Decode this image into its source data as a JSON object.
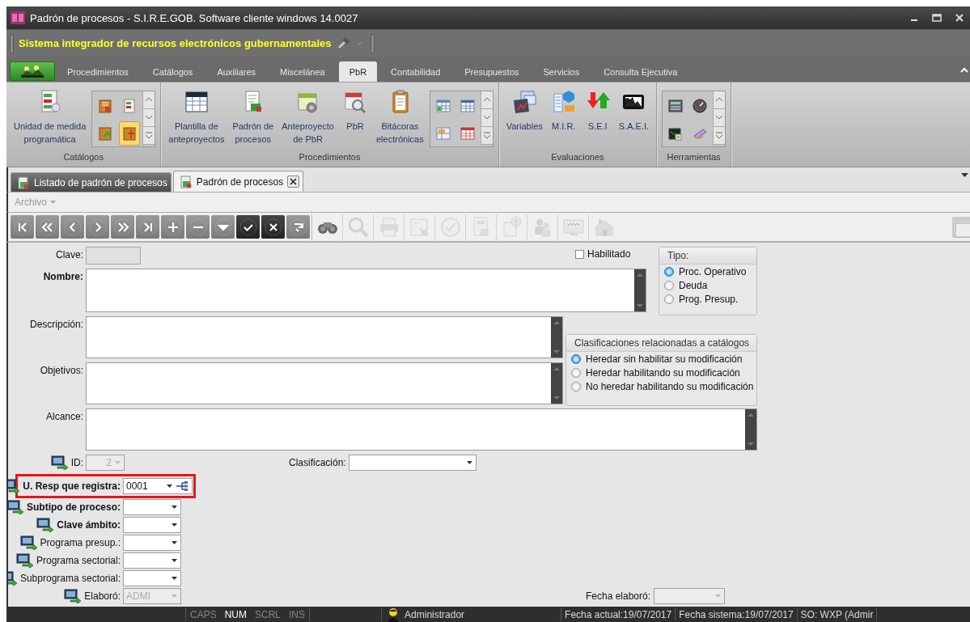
{
  "window": {
    "title": "Padrón de procesos - S.I.R.E.GOB. Software cliente windows 14.0027"
  },
  "header": {
    "system_name": "Sistema integrador de recursos electrónicos gubernamentales"
  },
  "ribbon_tabs": [
    {
      "label": "Procedimientos",
      "selected": false
    },
    {
      "label": "Catálogos",
      "selected": false
    },
    {
      "label": "Auxiliares",
      "selected": false
    },
    {
      "label": "Miscelánea",
      "selected": false
    },
    {
      "label": "PbR",
      "selected": true
    },
    {
      "label": "Contabilidad",
      "selected": false
    },
    {
      "label": "Presupuestos",
      "selected": false
    },
    {
      "label": "Servicios",
      "selected": false
    },
    {
      "label": "Consulta Ejecutiva",
      "selected": false
    }
  ],
  "ribbon_groups": [
    {
      "label": "Catálogos",
      "items": [
        {
          "kind": "large",
          "label": "Unidad de medida\nprogramática"
        },
        {
          "kind": "gallery",
          "cells": [
            {
              "selected": false
            },
            {
              "selected": false
            },
            {
              "selected": false
            },
            {
              "selected": true
            }
          ]
        }
      ]
    },
    {
      "label": "Procedimientos",
      "items": [
        {
          "kind": "large",
          "label": "Plantilla de\nanteproyectos"
        },
        {
          "kind": "large",
          "label": "Padrón de\nprocesos"
        },
        {
          "kind": "large",
          "label": "Anteproyecto\nde PbR"
        },
        {
          "kind": "large",
          "label": "PbR"
        },
        {
          "kind": "large",
          "label": "Bitácoras\nelectrónicas"
        },
        {
          "kind": "gallery",
          "cells": [
            {
              "selected": false
            },
            {
              "selected": false
            },
            {
              "selected": false
            },
            {
              "selected": false
            }
          ]
        }
      ]
    },
    {
      "label": "Evaluaciones",
      "items": [
        {
          "kind": "large",
          "label": "Variables"
        },
        {
          "kind": "large",
          "label": "M.I.R."
        },
        {
          "kind": "large",
          "label": "S.E.I"
        },
        {
          "kind": "large",
          "label": "S.A.E.I."
        }
      ]
    },
    {
      "label": "Herramientas",
      "items": [
        {
          "kind": "gallery",
          "cells": [
            {
              "selected": false
            },
            {
              "selected": false
            },
            {
              "selected": false
            },
            {
              "selected": false
            }
          ]
        }
      ]
    }
  ],
  "document_tabs": [
    {
      "label": "Listado de padrón de procesos",
      "selected": false,
      "closable": false
    },
    {
      "label": "Padrón de procesos",
      "selected": true,
      "closable": true
    }
  ],
  "menu": [
    {
      "label": "Archivo",
      "disabled": true
    }
  ],
  "toolbar": [
    {
      "kind": "first",
      "disabled": true
    },
    {
      "kind": "prev-page",
      "disabled": true
    },
    {
      "kind": "prev",
      "disabled": true
    },
    {
      "kind": "next",
      "disabled": true
    },
    {
      "kind": "next-page",
      "disabled": true
    },
    {
      "kind": "last",
      "disabled": true
    },
    {
      "kind": "add",
      "disabled": true
    },
    {
      "kind": "remove",
      "disabled": true
    },
    {
      "kind": "dropdown",
      "disabled": true
    },
    {
      "kind": "accept",
      "disabled": false
    },
    {
      "kind": "cancel",
      "disabled": false
    },
    {
      "kind": "redo",
      "disabled": true
    },
    {
      "kind": "binoculars",
      "disabled": false
    },
    {
      "kind": "search",
      "disabled": true
    },
    {
      "kind": "print",
      "disabled": true
    },
    {
      "kind": "form",
      "disabled": true
    },
    {
      "kind": "approve",
      "disabled": true
    },
    {
      "kind": "report",
      "disabled": true
    },
    {
      "kind": "info-document",
      "disabled": true
    },
    {
      "kind": "people",
      "disabled": true
    },
    {
      "kind": "web",
      "disabled": true
    },
    {
      "kind": "house",
      "disabled": true
    }
  ],
  "form": {
    "clave": {
      "label": "Clave:",
      "bold": false
    },
    "habilitado": {
      "label": "Habilitado",
      "checked": false
    },
    "nombre": {
      "label": "Nombre:",
      "bold": true
    },
    "descripcion": {
      "label": "Descripción:",
      "bold": false
    },
    "objetivos": {
      "label": "Objetivos:",
      "bold": false
    },
    "alcance": {
      "label": "Alcance:",
      "bold": false
    },
    "tipo": {
      "title": "Tipo:",
      "options": [
        {
          "label": "Proc. Operativo",
          "selected": true
        },
        {
          "label": "Deuda",
          "selected": false
        },
        {
          "label": "Prog. Presup.",
          "selected": false
        }
      ]
    },
    "clasificaciones": {
      "title": "Clasificaciones relacionadas a catálogos",
      "options": [
        {
          "label": "Heredar sin habilitar su modificación",
          "selected": true
        },
        {
          "label": "Heredar habilitando su modificación",
          "selected": false
        },
        {
          "label": "No heredar habilitando su modificación",
          "selected": false
        }
      ]
    },
    "id": {
      "label": "ID:",
      "value": "2",
      "disabled": true
    },
    "clasificacion": {
      "label": "Clasificación:"
    },
    "combos": [
      {
        "label": "U. Resp que registra:",
        "value": "0001",
        "bold": true,
        "highlighted": true,
        "disabled": false
      },
      {
        "label": "Subtipo de proceso:",
        "bold": true,
        "highlighted": false,
        "disabled": false
      },
      {
        "label": "Clave ámbito:",
        "bold": true,
        "highlighted": false,
        "disabled": false
      },
      {
        "label": "Programa presup.:",
        "bold": false,
        "highlighted": false,
        "disabled": false
      },
      {
        "label": "Programa sectorial:",
        "bold": false,
        "highlighted": false,
        "disabled": false
      },
      {
        "label": "Subprograma sectorial:",
        "bold": false,
        "highlighted": false,
        "disabled": false
      },
      {
        "label": "Elaboró:",
        "value": "ADMI",
        "bold": false,
        "highlighted": false,
        "disabled": true
      }
    ],
    "fecha_elaboro": {
      "label": "Fecha elaboró:",
      "disabled": true
    }
  },
  "status_bar": {
    "indicators": [
      {
        "label": "CAPS",
        "on": false
      },
      {
        "label": "NUM",
        "on": true
      },
      {
        "label": "SCRL",
        "on": false
      },
      {
        "label": "INS",
        "on": false
      }
    ],
    "user": "Administrador",
    "fecha_actual": "Fecha actual:19/07/2017",
    "fecha_sistema": "Fecha sistema:19/07/2017",
    "so": "SO: WXP (Admir"
  }
}
